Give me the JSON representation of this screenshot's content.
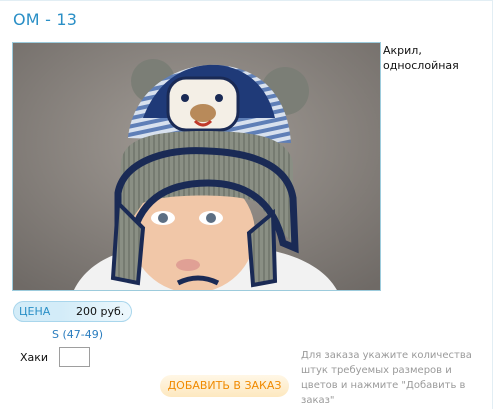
{
  "product": {
    "title": "OM - 13",
    "image_alt": "Шапка на манекене",
    "description": "Акрил, однослойная"
  },
  "price": {
    "label": "ЦЕНА",
    "value": "200 руб."
  },
  "size": {
    "label": "S (47-49)"
  },
  "color_row": {
    "label": "Хаки",
    "quantity_value": "",
    "quantity_placeholder": ""
  },
  "order": {
    "button_label": "ДОБАВИТЬ В ЗАКАЗ",
    "hint": "Для заказа укажите количества штук требуемых размеров и цветов и нажмите \"Добавить в заказ\""
  },
  "colors": {
    "accent": "#2a8fc6",
    "button_text": "#f08a00",
    "hint_text": "#9a9a9a"
  }
}
